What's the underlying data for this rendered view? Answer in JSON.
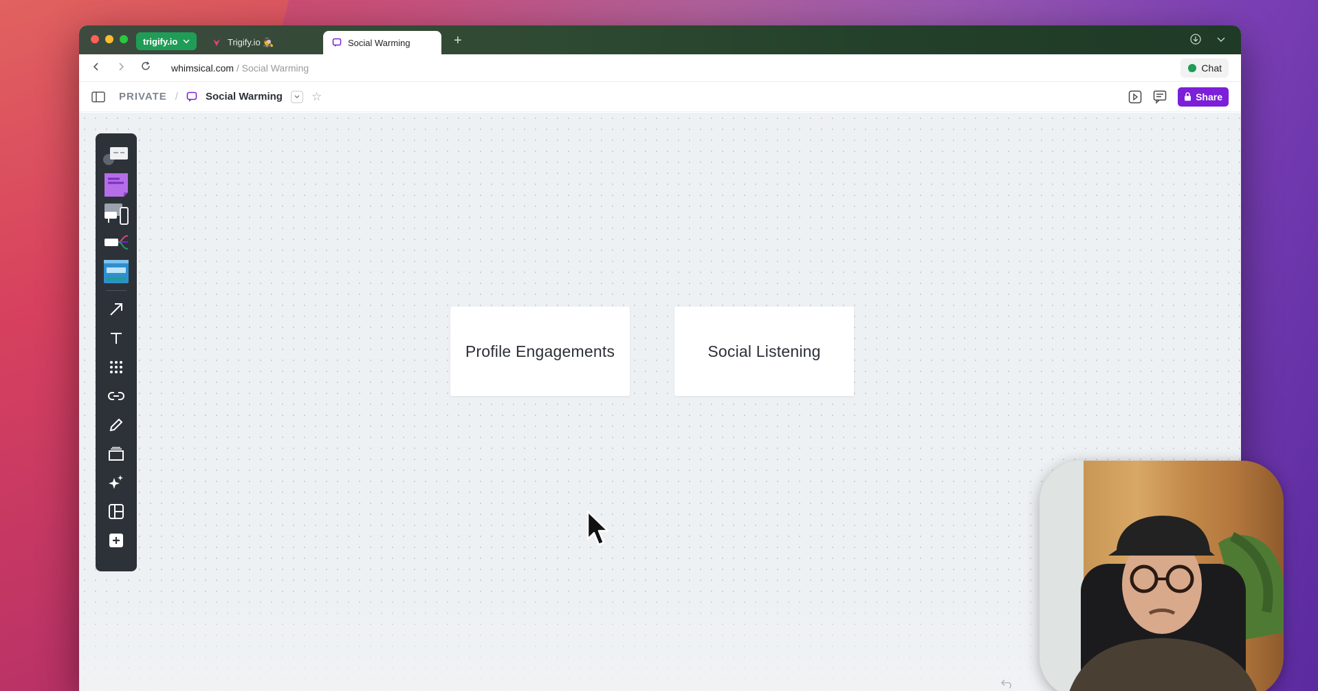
{
  "browser": {
    "workspace_pill": "trigify.io",
    "tabs": [
      {
        "label": "Trigify.io 🕵️"
      },
      {
        "label": "Social Warming"
      }
    ],
    "url_host": "whimsical.com",
    "url_path": " / Social Warming",
    "chat_label": "Chat"
  },
  "app": {
    "breadcrumb_private": "PRIVATE",
    "breadcrumb_sep": "/",
    "board_title": "Social Warming",
    "share_label": "Share",
    "accent_color": "#7b1fd8"
  },
  "tools": [
    {
      "icon": "flowchart-icon"
    },
    {
      "icon": "sticky-note-icon"
    },
    {
      "icon": "wireframe-icon"
    },
    {
      "icon": "mindmap-icon"
    },
    {
      "icon": "doc-icon"
    },
    {
      "icon": "arrow-icon"
    },
    {
      "icon": "text-icon"
    },
    {
      "icon": "grid-icon"
    },
    {
      "icon": "link-icon"
    },
    {
      "icon": "pencil-icon"
    },
    {
      "icon": "frame-icon"
    },
    {
      "icon": "ai-sparkle-icon"
    },
    {
      "icon": "layout-icon"
    },
    {
      "icon": "add-icon"
    }
  ],
  "canvas": {
    "cards": [
      {
        "label": "Profile Engagements"
      },
      {
        "label": "Social Listening"
      }
    ]
  }
}
